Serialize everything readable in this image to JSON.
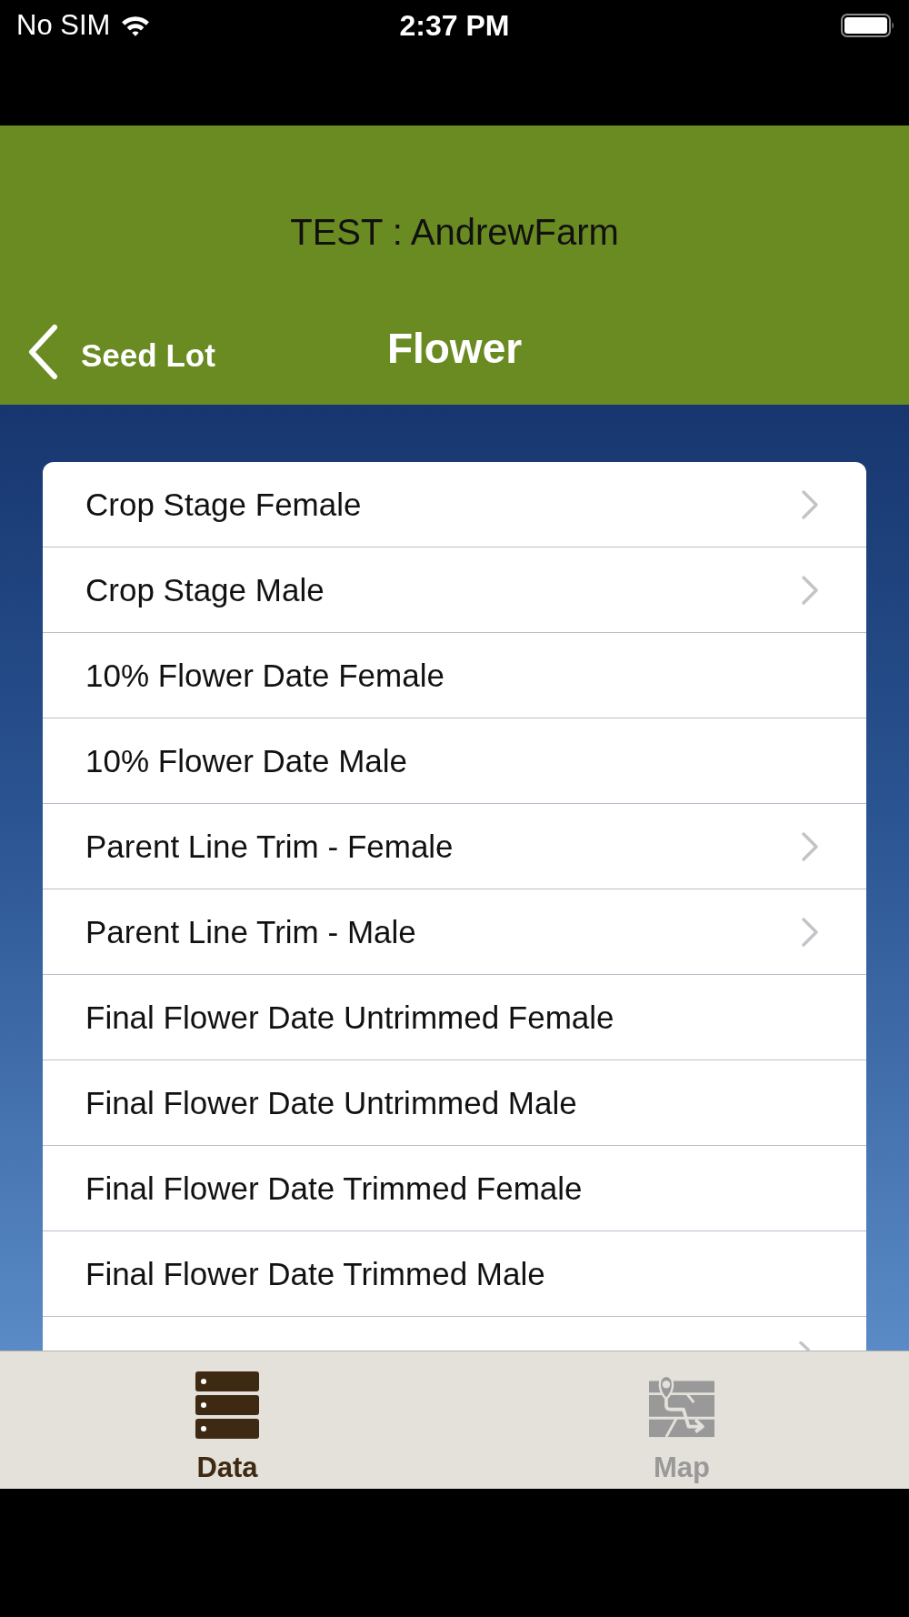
{
  "status_bar": {
    "carrier": "No SIM",
    "time": "2:37 PM"
  },
  "header": {
    "title": "TEST : AndrewFarm",
    "back_label": "Seed Lot",
    "screen_title": "Flower"
  },
  "rows": [
    {
      "label": "Crop Stage Female",
      "chevron": true
    },
    {
      "label": "Crop Stage Male",
      "chevron": true
    },
    {
      "label": "10% Flower Date Female",
      "chevron": false
    },
    {
      "label": "10% Flower Date Male",
      "chevron": false
    },
    {
      "label": "Parent Line Trim - Female",
      "chevron": true
    },
    {
      "label": "Parent Line Trim - Male",
      "chevron": true
    },
    {
      "label": "Final Flower Date Untrimmed Female",
      "chevron": false
    },
    {
      "label": "Final Flower Date Untrimmed Male",
      "chevron": false
    },
    {
      "label": "Final Flower Date Trimmed Female",
      "chevron": false
    },
    {
      "label": "Final Flower Date Trimmed Male",
      "chevron": false
    }
  ],
  "partial_row": {
    "chevron": true
  },
  "tabs": [
    {
      "label": "Data",
      "kind": "data",
      "selected": true
    },
    {
      "label": "Map",
      "kind": "map",
      "selected": false
    }
  ]
}
